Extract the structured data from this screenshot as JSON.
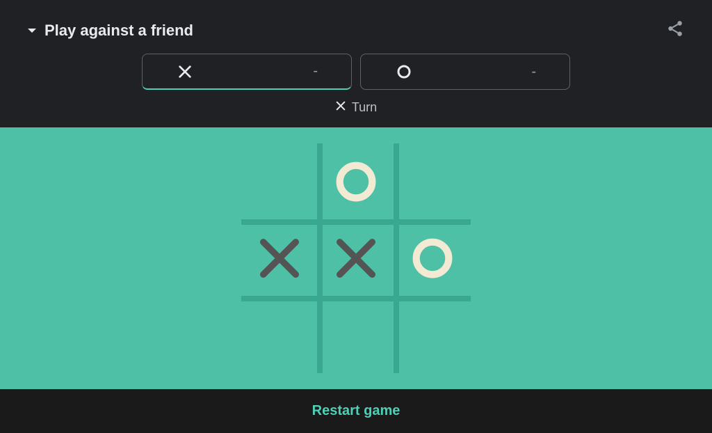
{
  "header": {
    "mode_label": "Play against a friend"
  },
  "scores": {
    "x": {
      "value": "-",
      "active": true
    },
    "o": {
      "value": "-",
      "active": false
    }
  },
  "turn": {
    "player": "X",
    "label": "Turn"
  },
  "board": {
    "cells": [
      "",
      "O",
      "",
      "X",
      "X",
      "O",
      "",
      "",
      ""
    ]
  },
  "footer": {
    "restart_label": "Restart game"
  },
  "colors": {
    "accent": "#4dd0b5",
    "board_bg": "#4dc0a6",
    "x_mark": "#545454",
    "o_mark": "#f2ead3"
  }
}
